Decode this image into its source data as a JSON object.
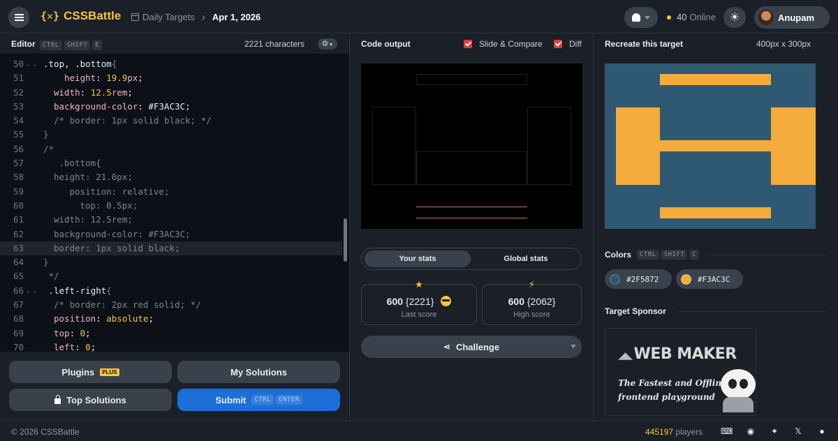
{
  "header": {
    "logo_mark": "{✕}",
    "logo_text": "CSSBattle",
    "breadcrumb_parent": "Daily Targets",
    "breadcrumb_current": "Apr 1, 2026",
    "online_count": "40",
    "online_label": "Online",
    "user_name": "Anupam"
  },
  "editor": {
    "title": "Editor",
    "shortcut": [
      "CTRL",
      "SHIFT",
      "E"
    ],
    "char_count": "2221 characters",
    "lines": [
      {
        "n": "50",
        "fold": "⌄ ⌄",
        "indent": 0,
        "segs": [
          {
            "c": "sel",
            "t": ".top, .bottom"
          },
          {
            "c": "com",
            "t": "{"
          }
        ]
      },
      {
        "n": "51",
        "fold": "",
        "indent": 4,
        "segs": [
          {
            "c": "prop",
            "t": "height"
          },
          {
            "c": "sel",
            "t": ": "
          },
          {
            "c": "num",
            "t": "19.9"
          },
          {
            "c": "unit",
            "t": "px"
          },
          {
            "c": "sel",
            "t": ";"
          }
        ]
      },
      {
        "n": "52",
        "fold": "",
        "indent": 2,
        "segs": [
          {
            "c": "prop",
            "t": "width"
          },
          {
            "c": "sel",
            "t": ": "
          },
          {
            "c": "num",
            "t": "12.5"
          },
          {
            "c": "unit",
            "t": "rem"
          },
          {
            "c": "sel",
            "t": ";"
          }
        ]
      },
      {
        "n": "53",
        "fold": "",
        "indent": 2,
        "segs": [
          {
            "c": "prop",
            "t": "background-color"
          },
          {
            "c": "sel",
            "t": ": "
          },
          {
            "c": "sel",
            "t": "#F3AC3C"
          },
          {
            "c": "sel",
            "t": ";"
          }
        ]
      },
      {
        "n": "54",
        "fold": "",
        "indent": 2,
        "segs": [
          {
            "c": "com",
            "t": "/* border: 1px solid black; */"
          }
        ]
      },
      {
        "n": "55",
        "fold": "",
        "indent": 0,
        "segs": [
          {
            "c": "com",
            "t": "}"
          }
        ]
      },
      {
        "n": "56",
        "fold": "",
        "indent": 0,
        "segs": [
          {
            "c": "com",
            "t": "/*"
          }
        ]
      },
      {
        "n": "57",
        "fold": "",
        "indent": 3,
        "segs": [
          {
            "c": "com",
            "t": ".bottom{"
          }
        ]
      },
      {
        "n": "58",
        "fold": "",
        "indent": 2,
        "segs": [
          {
            "c": "com",
            "t": "height: 21.0px;"
          }
        ]
      },
      {
        "n": "59",
        "fold": "",
        "indent": 5,
        "segs": [
          {
            "c": "com",
            "t": "position: relative;"
          }
        ]
      },
      {
        "n": "60",
        "fold": "",
        "indent": 7,
        "segs": [
          {
            "c": "com",
            "t": "top: 0.5px;"
          }
        ]
      },
      {
        "n": "61",
        "fold": "",
        "indent": 2,
        "segs": [
          {
            "c": "com",
            "t": "width: 12.5rem;"
          }
        ]
      },
      {
        "n": "62",
        "fold": "",
        "indent": 2,
        "segs": [
          {
            "c": "com",
            "t": "background-color: #F3AC3C;"
          }
        ]
      },
      {
        "n": "63",
        "fold": "",
        "indent": 2,
        "hl": true,
        "segs": [
          {
            "c": "com",
            "t": "border: 1px solid black;"
          }
        ]
      },
      {
        "n": "64",
        "fold": "",
        "indent": 0,
        "segs": [
          {
            "c": "com",
            "t": "}"
          }
        ]
      },
      {
        "n": "65",
        "fold": "",
        "indent": 1,
        "segs": [
          {
            "c": "com",
            "t": "*/"
          }
        ]
      },
      {
        "n": "66",
        "fold": "⌄ ⌄",
        "indent": 1,
        "segs": [
          {
            "c": "sel",
            "t": ".left-right"
          },
          {
            "c": "com",
            "t": "{"
          }
        ]
      },
      {
        "n": "67",
        "fold": "",
        "indent": 2,
        "segs": [
          {
            "c": "com",
            "t": "/* border: 2px red solid; */"
          }
        ]
      },
      {
        "n": "68",
        "fold": "",
        "indent": 2,
        "segs": [
          {
            "c": "prop",
            "t": "position"
          },
          {
            "c": "sel",
            "t": ": "
          },
          {
            "c": "val",
            "t": "absolute"
          },
          {
            "c": "sel",
            "t": ";"
          }
        ]
      },
      {
        "n": "69",
        "fold": "",
        "indent": 2,
        "segs": [
          {
            "c": "prop",
            "t": "top"
          },
          {
            "c": "sel",
            "t": ": "
          },
          {
            "c": "num",
            "t": "0"
          },
          {
            "c": "sel",
            "t": ";"
          }
        ]
      },
      {
        "n": "70",
        "fold": "",
        "indent": 2,
        "segs": [
          {
            "c": "prop",
            "t": "left"
          },
          {
            "c": "sel",
            "t": ": "
          },
          {
            "c": "num",
            "t": "0"
          },
          {
            "c": "sel",
            "t": ";"
          }
        ]
      }
    ]
  },
  "buttons": {
    "plugins": "Plugins",
    "plugins_badge": "PLUS",
    "my_solutions": "My Solutions",
    "top_solutions": "Top Solutions",
    "submit": "Submit",
    "submit_keys": [
      "CTRL",
      "ENTER"
    ]
  },
  "output": {
    "title": "Code output",
    "slide_compare": "Slide & Compare",
    "diff": "Diff"
  },
  "stats": {
    "tab_yours": "Your stats",
    "tab_global": "Global stats",
    "last_score": "600",
    "last_chars": "{2221}",
    "last_label": "Last score",
    "high_score": "600",
    "high_chars": "{2062}",
    "high_label": "High score",
    "challenge": "Challenge"
  },
  "target": {
    "title": "Recreate this target",
    "dims": "400px x 300px",
    "colors_label": "Colors",
    "colors_shortcut": [
      "CTRL",
      "SHIFT",
      "C"
    ],
    "colors": [
      "#2F5872",
      "#F3AC3C"
    ],
    "sponsor_label": "Target Sponsor",
    "sponsor_brand": "WEB MAKER",
    "sponsor_tag_1": "The Fastest and Offline",
    "sponsor_tag_2": "frontend playground"
  },
  "footer": {
    "copyright": "© 2026 CSSBattle",
    "players_count": "445197",
    "players_label": "players"
  }
}
